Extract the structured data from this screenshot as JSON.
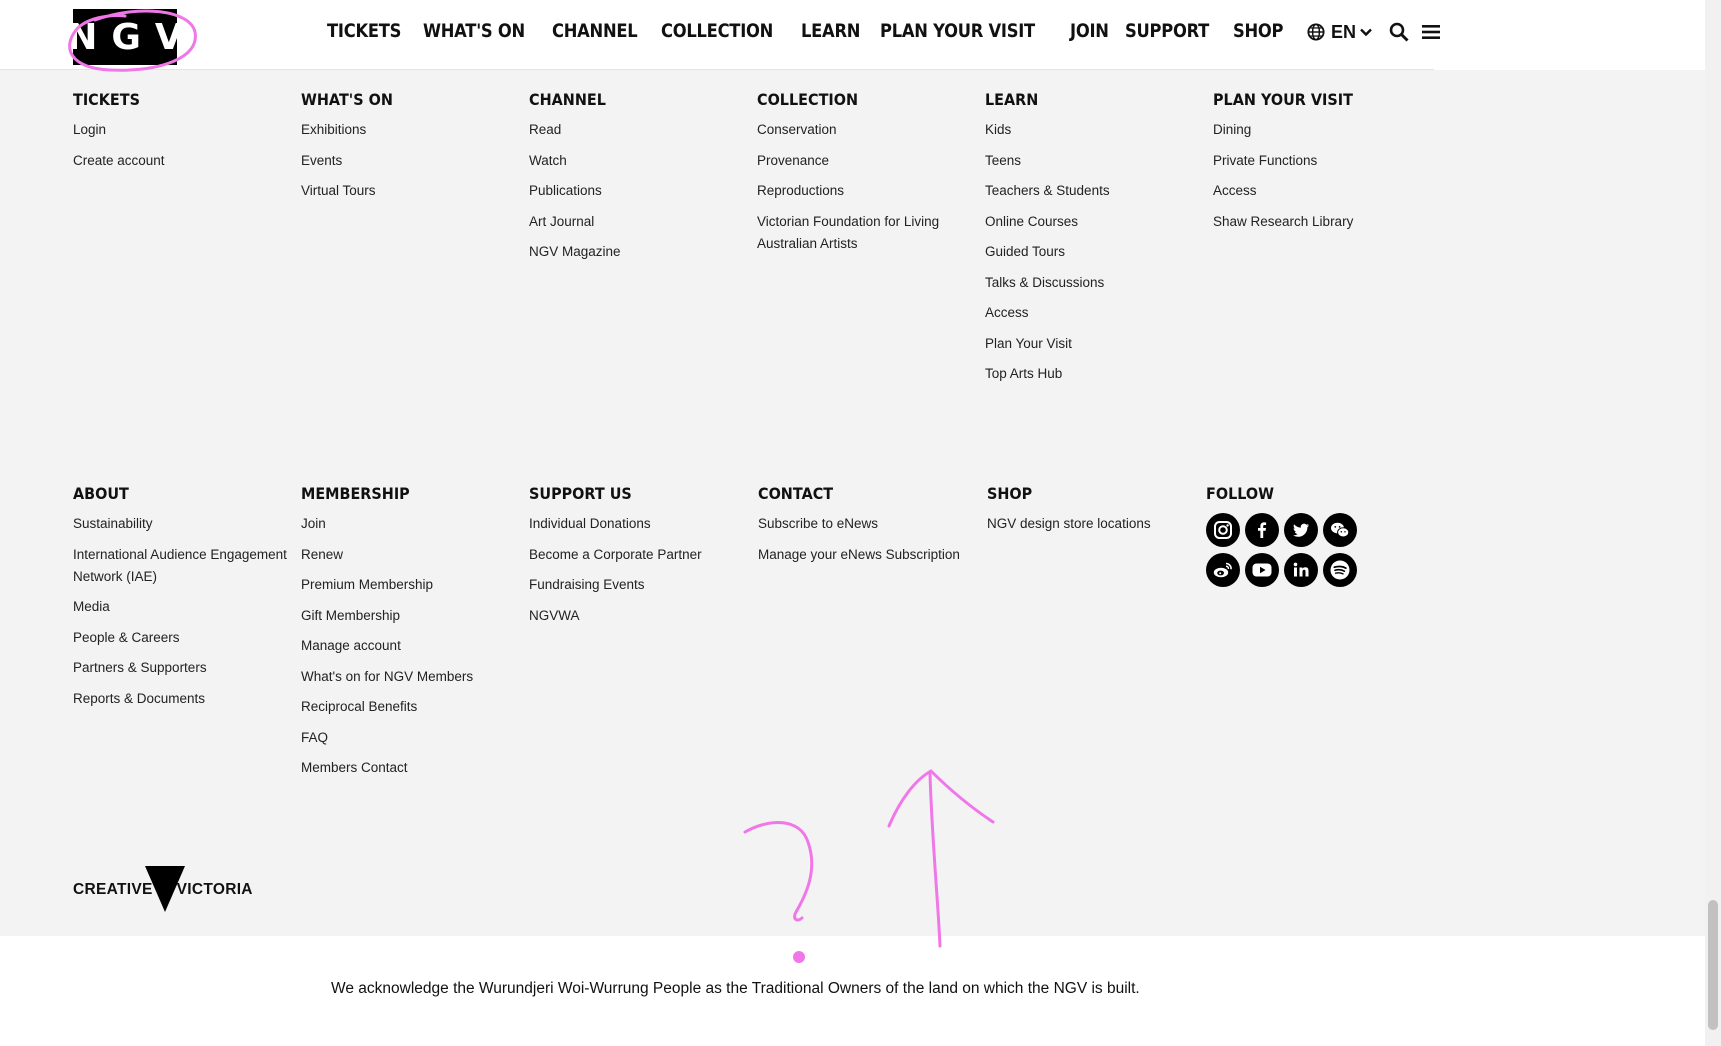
{
  "header": {
    "logo_text": "NGV",
    "nav": [
      "TICKETS",
      "WHAT'S ON",
      "CHANNEL",
      "COLLECTION",
      "LEARN",
      "PLAN YOUR VISIT",
      "JOIN",
      "SUPPORT",
      "SHOP"
    ],
    "language": "EN",
    "icons": [
      "globe-icon",
      "chevron-down-icon",
      "search-icon",
      "menu-icon"
    ]
  },
  "footer_top": [
    {
      "heading": "TICKETS",
      "links": [
        "Login",
        "Create account"
      ]
    },
    {
      "heading": "WHAT'S ON",
      "links": [
        "Exhibitions",
        "Events",
        "Virtual Tours"
      ]
    },
    {
      "heading": "CHANNEL",
      "links": [
        "Read",
        "Watch",
        "Publications",
        "Art Journal",
        "NGV Magazine"
      ]
    },
    {
      "heading": "COLLECTION",
      "links": [
        "Conservation",
        "Provenance",
        "Reproductions",
        "Victorian Foundation for Living Australian Artists"
      ]
    },
    {
      "heading": "LEARN",
      "links": [
        "Kids",
        "Teens",
        "Teachers & Students",
        "Online Courses",
        "Guided Tours",
        "Talks & Discussions",
        "Access",
        "Plan Your Visit",
        "Top Arts Hub"
      ]
    },
    {
      "heading": "PLAN YOUR VISIT",
      "links": [
        "Dining",
        "Private Functions",
        "Access",
        "Shaw Research Library"
      ]
    }
  ],
  "footer_bottom": [
    {
      "heading": "ABOUT",
      "links": [
        "Sustainability",
        "International Audience Engagement Network (IAE)",
        "Media",
        "People & Careers",
        "Partners & Supporters",
        "Reports & Documents"
      ]
    },
    {
      "heading": "MEMBERSHIP",
      "links": [
        "Join",
        "Renew",
        "Premium Membership",
        "Gift Membership",
        "Manage account",
        "What's on for NGV Members",
        "Reciprocal Benefits",
        "FAQ",
        "Members Contact"
      ]
    },
    {
      "heading": "SUPPORT US",
      "links": [
        "Individual Donations",
        "Become a Corporate Partner",
        "Fundraising Events",
        "NGVWA"
      ]
    },
    {
      "heading": "CONTACT",
      "links": [
        "Subscribe to eNews",
        "Manage your eNews Subscription"
      ]
    },
    {
      "heading": "SHOP",
      "links": [
        "NGV design store locations"
      ]
    }
  ],
  "follow": {
    "heading": "FOLLOW",
    "icons": [
      "instagram-icon",
      "facebook-icon",
      "twitter-icon",
      "wechat-icon",
      "weibo-icon",
      "youtube-icon",
      "linkedin-icon",
      "spotify-icon"
    ]
  },
  "creative_victoria": {
    "left": "CREATIVE",
    "right": "VICTORIA"
  },
  "acknowledgement": "We acknowledge the Wurundjeri Woi-Wurrung People as the Traditional Owners of the land on which the NGV is built.",
  "colors": {
    "annotation": "#f077e8",
    "footer_bg": "#f3f3f3",
    "text": "#111111"
  }
}
